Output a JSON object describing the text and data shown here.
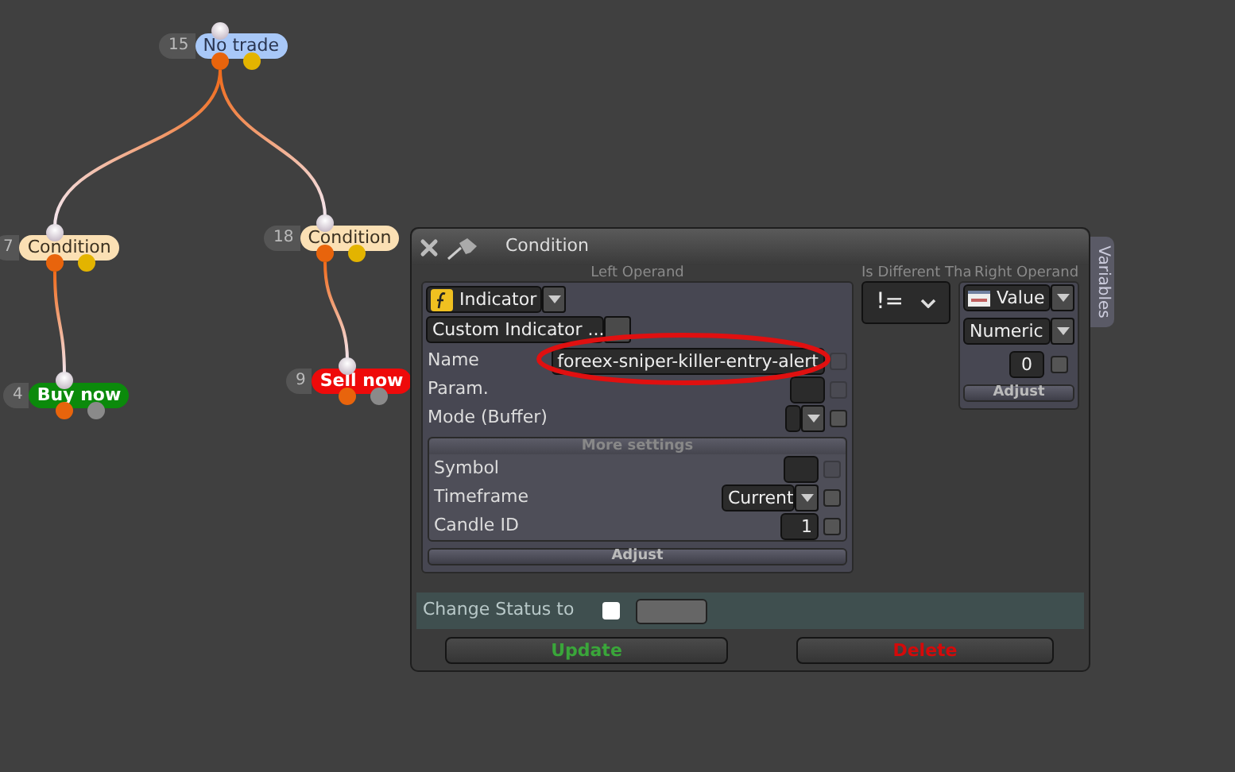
{
  "canvas": {
    "nodes": [
      {
        "number": "15",
        "label": "No trade",
        "kind": "start",
        "children": [
          {
            "number": "7",
            "label": "Condition",
            "kind": "condition",
            "children": [
              {
                "number": "4",
                "label": "Buy now",
                "kind": "buy"
              }
            ]
          },
          {
            "number": "18",
            "label": "Condition",
            "kind": "condition",
            "children": [
              {
                "number": "9",
                "label": "Sell now",
                "kind": "sell"
              }
            ]
          }
        ]
      }
    ]
  },
  "dialog": {
    "title": "Condition",
    "variables_tab": "Variables",
    "left_operand": {
      "heading": "Left Operand",
      "type": "Indicator",
      "source": "Custom Indicator ...",
      "fields": [
        {
          "label": "Name",
          "kind": "text",
          "value": "foreex-sniper-killer-entry-alert",
          "circled": true,
          "checked": false
        },
        {
          "label": "Param.",
          "kind": "box",
          "checked": false
        },
        {
          "label": "Mode (Buffer)",
          "kind": "select",
          "checked": false
        }
      ],
      "more": {
        "heading": "More settings",
        "fields": [
          {
            "label": "Symbol",
            "kind": "box",
            "checked": false
          },
          {
            "label": "Timeframe",
            "kind": "select",
            "value": "Current",
            "checked": false
          },
          {
            "label": "Candle ID",
            "kind": "text",
            "value": "1",
            "checked": false
          }
        ]
      },
      "adjust": "Adjust"
    },
    "operator": {
      "heading": "Is Different Tha",
      "symbol": "!="
    },
    "right_operand": {
      "heading": "Right Operand",
      "type": "Value",
      "subtype": "Numeric",
      "value": "0",
      "checked": false,
      "adjust": "Adjust"
    },
    "status": {
      "label": "Change Status to",
      "checked": false
    },
    "buttons": [
      {
        "label": "Update",
        "kind": "update"
      },
      {
        "label": "Delete",
        "kind": "delete"
      }
    ]
  }
}
